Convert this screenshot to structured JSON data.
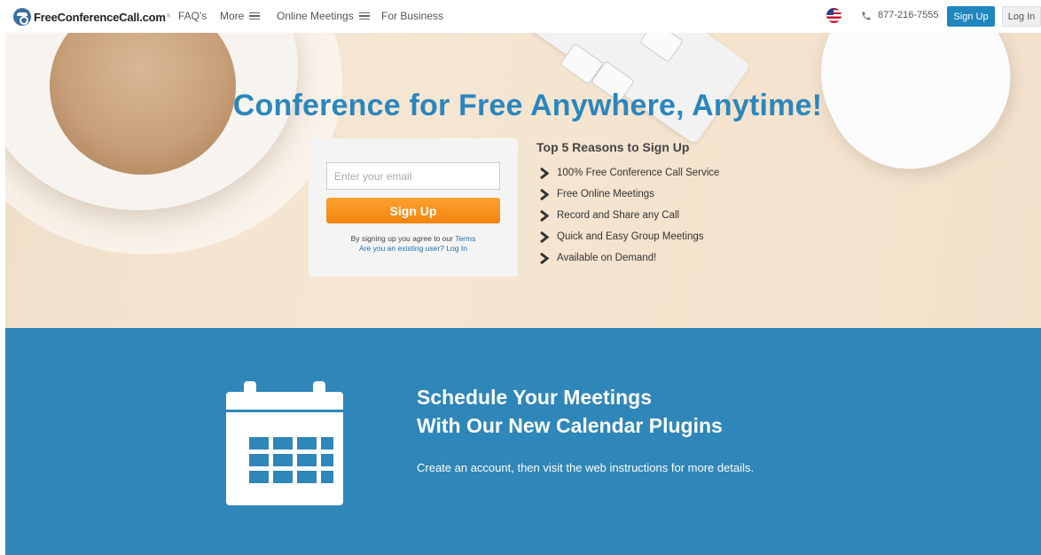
{
  "nav": {
    "logo_text": "FreeConferenceCall.com",
    "logo_reg": "®",
    "faq": "FAQ's",
    "more": "More",
    "online_meetings": "Online Meetings",
    "for_business": "For Business",
    "flag_icon": "us-flag-icon",
    "phone_icon": "phone-icon",
    "phone": "877-216-7555",
    "signup": "Sign Up",
    "login": "Log In"
  },
  "hero": {
    "headline": "Conference for Free Anywhere, Anytime!",
    "email_placeholder": "Enter your email",
    "signup_button": "Sign Up",
    "terms_prefix": "By signing up you agree to our ",
    "terms_link": "Terms",
    "existing_prefix": "Are you an existing user? ",
    "login_link": "Log In",
    "reasons_title": "Top 5 Reasons to Sign Up",
    "reasons": [
      "100% Free Conference Call Service",
      "Free Online Meetings",
      "Record and Share any Call",
      "Quick and Easy Group Meetings",
      "Available on Demand!"
    ]
  },
  "promo": {
    "icon": "calendar-icon",
    "title_line1": "Schedule Your Meetings",
    "title_line2": "With Our New Calendar Plugins",
    "subtitle": "Create an account, then visit the web instructions for more details."
  },
  "colors": {
    "brand_blue": "#2b86bd",
    "section_blue": "#2f86b8",
    "cta_orange": "#f48410"
  }
}
